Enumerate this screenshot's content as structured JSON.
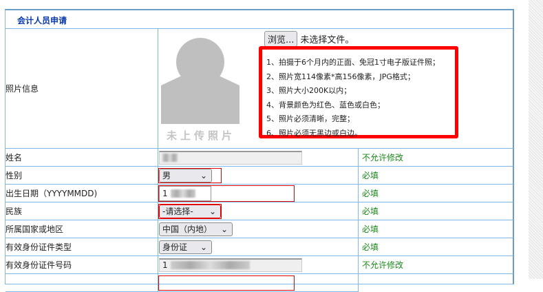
{
  "title": "会计人员申请",
  "photo": {
    "label": "照片信息",
    "placeholder_text": "未上传照片",
    "browse_label": "浏览...",
    "file_status": "未选择文件。",
    "notes": [
      "1、拍摄于6个月内的正面、免冠1寸电子版证件照；",
      "2、照片宽114像素*高156像素，JPG格式；",
      "3、照片大小200K以内；",
      "4、背景颜色为红色、蓝色或白色；",
      "5、照片必须清晰，完整；",
      "6、照片必须无黑边或白边。"
    ]
  },
  "rows": [
    {
      "label": "姓名",
      "value": "",
      "note": "不允许修改"
    },
    {
      "label": "性别",
      "value": "男",
      "note": "必填"
    },
    {
      "label": "出生日期（YYYYMMDD)",
      "value": "1",
      "note": "必填"
    },
    {
      "label": "民族",
      "value": "-请选择-",
      "note": "必填"
    },
    {
      "label": "所属国家或地区",
      "value": "中国（内地）",
      "note": "必填"
    },
    {
      "label": "有效身份证件类型",
      "value": "身份证",
      "note": "必填"
    },
    {
      "label": "有效身份证件号码",
      "value": "1",
      "note": "不允许修改"
    }
  ]
}
